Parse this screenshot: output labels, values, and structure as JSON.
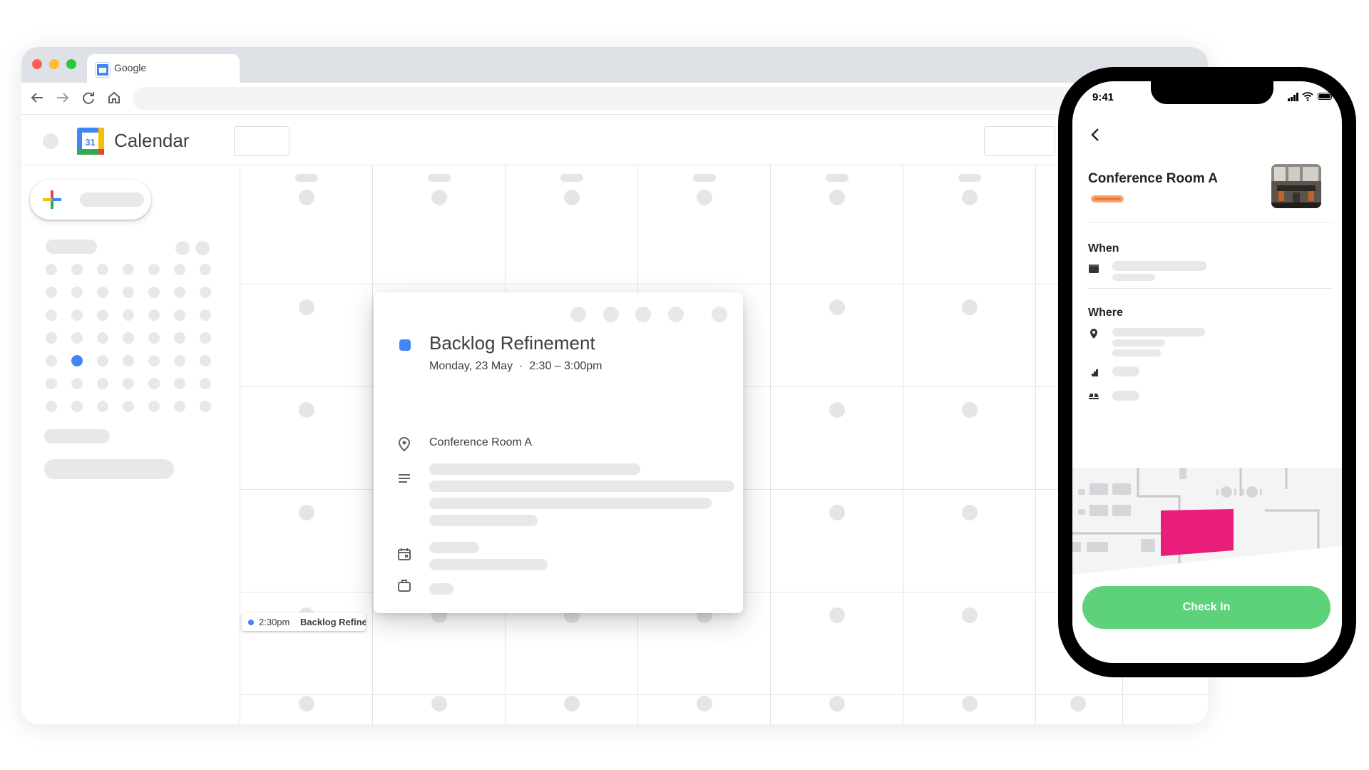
{
  "browser": {
    "tab_title": "Google",
    "app_name": "Calendar",
    "calendar_icon_day": "31"
  },
  "event_chip": {
    "time": "2:30pm",
    "title": "Backlog Refiner"
  },
  "popup": {
    "title": "Backlog Refinement",
    "date": "Monday, 23 May",
    "separator": "·",
    "time_range": "2:30 – 3:00pm",
    "location": "Conference Room A",
    "event_color": "#4285f4"
  },
  "phone": {
    "status_time": "9:41",
    "room_title": "Conference Room A",
    "when_label": "When",
    "where_label": "Where",
    "check_in_label": "Check In",
    "check_in_color": "#5dd27a",
    "highlight_color": "#e91e7b"
  }
}
